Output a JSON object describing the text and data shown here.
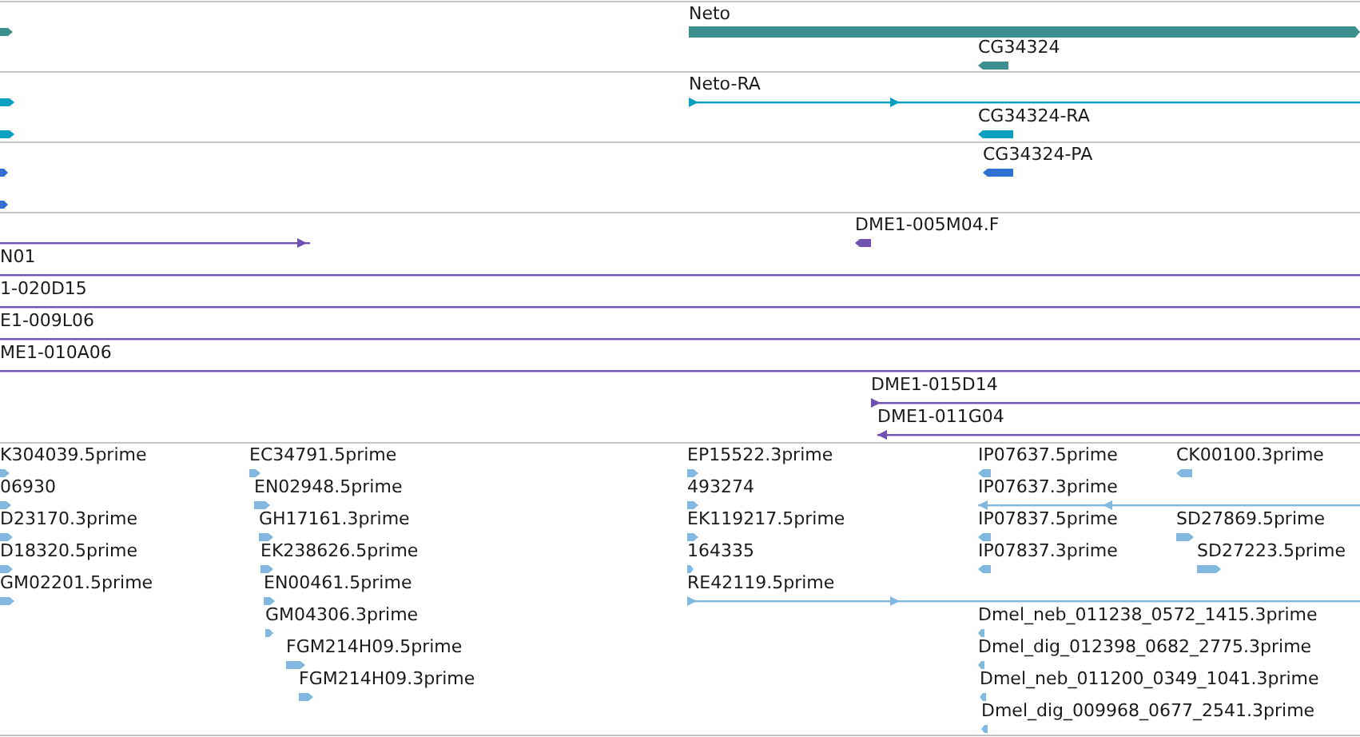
{
  "tracks": [
    {
      "color": "#3d8f8f",
      "features": [
        {
          "kind": "block",
          "reverse": false
        },
        {
          "kind": "block",
          "label": "Neto",
          "reverse": false
        },
        {
          "kind": "block",
          "label": "CG34324",
          "reverse": true
        }
      ]
    },
    {
      "color": "#0aa0c0",
      "features": [
        {
          "kind": "block",
          "reverse": false
        },
        {
          "kind": "line",
          "label": "Neto-RA",
          "reverse": false
        },
        {
          "kind": "block",
          "reverse": false
        },
        {
          "kind": "block",
          "label": "CG34324-RA",
          "reverse": true
        }
      ]
    },
    {
      "color": "#3070d0",
      "features": [
        {
          "kind": "block",
          "reverse": false
        },
        {
          "kind": "block",
          "label": "CG34324-PA",
          "reverse": true
        },
        {
          "kind": "block",
          "reverse": false
        }
      ]
    },
    {
      "color": "#7050b0",
      "features": [
        {
          "kind": "line",
          "reverse": false
        },
        {
          "kind": "block",
          "label": "DME1-005M04.F",
          "reverse": true
        },
        {
          "kind": "line",
          "label": "N01"
        },
        {
          "kind": "line",
          "label": "1-020D15"
        },
        {
          "kind": "line",
          "label": "E1-009L06"
        },
        {
          "kind": "line",
          "label": "ME1-010A06"
        },
        {
          "kind": "line",
          "label": "DME1-015D14",
          "reverse": false
        },
        {
          "kind": "line",
          "label": "DME1-011G04",
          "reverse": true
        }
      ]
    },
    {
      "color": "#80b8e0",
      "features": [
        {
          "kind": "block",
          "label": "K304039.5prime",
          "reverse": false
        },
        {
          "kind": "block",
          "label": "EC34791.5prime",
          "reverse": false
        },
        {
          "kind": "block",
          "label": "EP15522.3prime",
          "reverse": false
        },
        {
          "kind": "block",
          "label": "IP07637.5prime",
          "reverse": true
        },
        {
          "kind": "block",
          "label": "CK00100.3prime",
          "reverse": true
        },
        {
          "kind": "block",
          "label": "06930",
          "reverse": false
        },
        {
          "kind": "block",
          "label": "EN02948.5prime",
          "reverse": false
        },
        {
          "kind": "block",
          "label": "493274",
          "reverse": false
        },
        {
          "kind": "line",
          "label": "IP07637.3prime",
          "reverse": true
        },
        {
          "kind": "block",
          "label": "D23170.3prime",
          "reverse": false
        },
        {
          "kind": "block",
          "label": "GH17161.3prime",
          "reverse": false
        },
        {
          "kind": "block",
          "label": "EK119217.5prime",
          "reverse": false
        },
        {
          "kind": "block",
          "label": "IP07837.5prime",
          "reverse": true
        },
        {
          "kind": "block",
          "label": "SD27869.5prime",
          "reverse": false
        },
        {
          "kind": "block",
          "label": "D18320.5prime",
          "reverse": false
        },
        {
          "kind": "block",
          "label": "EK238626.5prime",
          "reverse": false
        },
        {
          "kind": "block",
          "label": "164335",
          "reverse": false
        },
        {
          "kind": "block",
          "label": "IP07837.3prime",
          "reverse": true
        },
        {
          "kind": "block",
          "label": "SD27223.5prime",
          "reverse": false
        },
        {
          "kind": "block",
          "label": "GM02201.5prime",
          "reverse": false
        },
        {
          "kind": "block",
          "label": "EN00461.5prime",
          "reverse": false
        },
        {
          "kind": "line",
          "label": "RE42119.5prime",
          "reverse": false
        },
        {
          "kind": "block",
          "label": "GM04306.3prime",
          "reverse": false
        },
        {
          "kind": "block",
          "label": "Dmel_neb_011238_0572_1415.3prime",
          "reverse": true
        },
        {
          "kind": "block",
          "label": "FGM214H09.5prime",
          "reverse": false
        },
        {
          "kind": "block",
          "label": "Dmel_dig_012398_0682_2775.3prime",
          "reverse": true
        },
        {
          "kind": "block",
          "label": "FGM214H09.3prime",
          "reverse": false
        },
        {
          "kind": "block",
          "label": "Dmel_neb_011200_0349_1041.3prime",
          "reverse": true
        },
        {
          "kind": "block",
          "label": "Dmel_dig_009968_0677_2541.3prime",
          "reverse": true
        }
      ]
    }
  ]
}
